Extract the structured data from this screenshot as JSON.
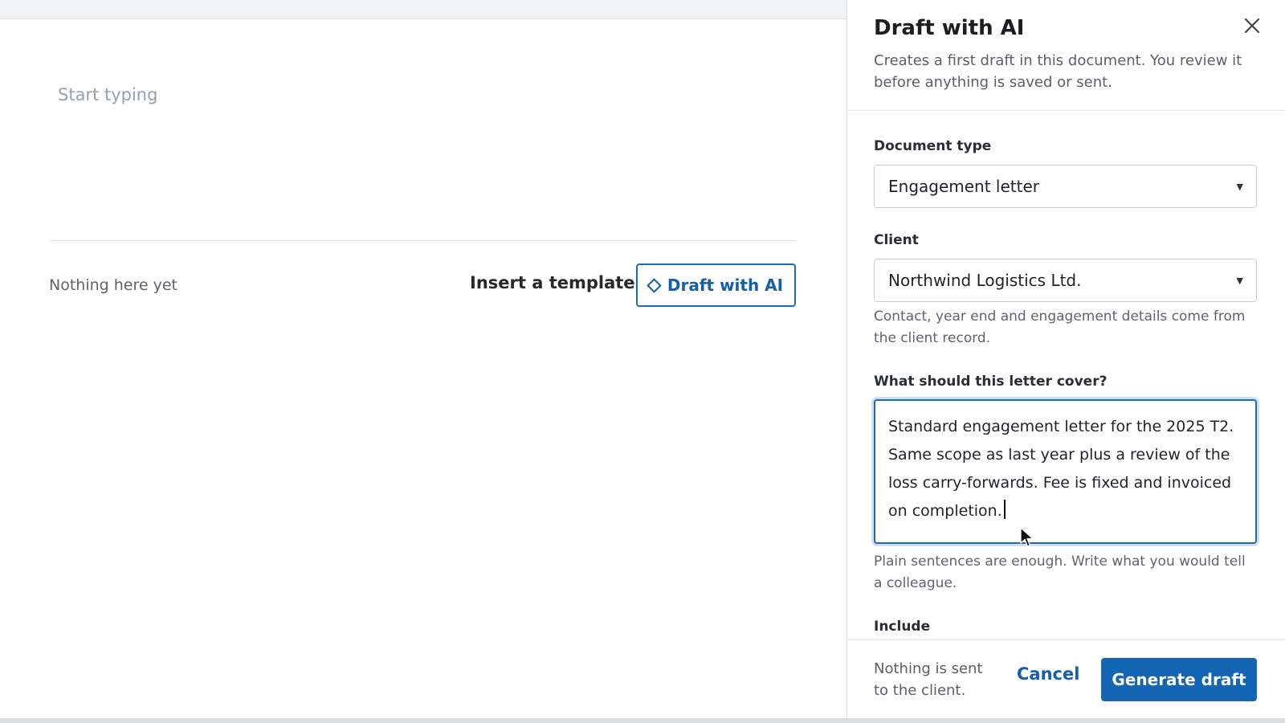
{
  "editor": {
    "placeholder": "Start typing",
    "empty_state": "Nothing here yet",
    "insert_template_label": "Insert a template",
    "draft_ai_label": "Draft with AI"
  },
  "panel": {
    "title": "Draft with AI",
    "description": "Creates a first draft in this document. You review it before anything is saved or sent.",
    "document_type": {
      "label": "Document type",
      "value": "Engagement letter"
    },
    "client": {
      "label": "Client",
      "value": "Northwind Logistics Ltd.",
      "hint": "Contact, year end and engagement details come from the client record."
    },
    "cover": {
      "label": "What should this letter cover?",
      "value": "Standard engagement letter for the 2025 T2. Same scope as last year plus a review of the loss carry-forwards. Fee is fixed and invoiced on completion.",
      "hint": "Plain sentences are enough. Write what you would tell a colleague."
    },
    "include_label": "Include",
    "footer": {
      "note": "Nothing is sent to the client.",
      "cancel_label": "Cancel",
      "generate_label": "Generate draft"
    }
  },
  "colors": {
    "accent": "#1565b5",
    "focus_ring": "#cfe0f3",
    "muted_text": "#5a5f66"
  },
  "icons": [
    "close-icon",
    "diamond-icon",
    "chevron-down-icon",
    "mouse-pointer-icon"
  ]
}
